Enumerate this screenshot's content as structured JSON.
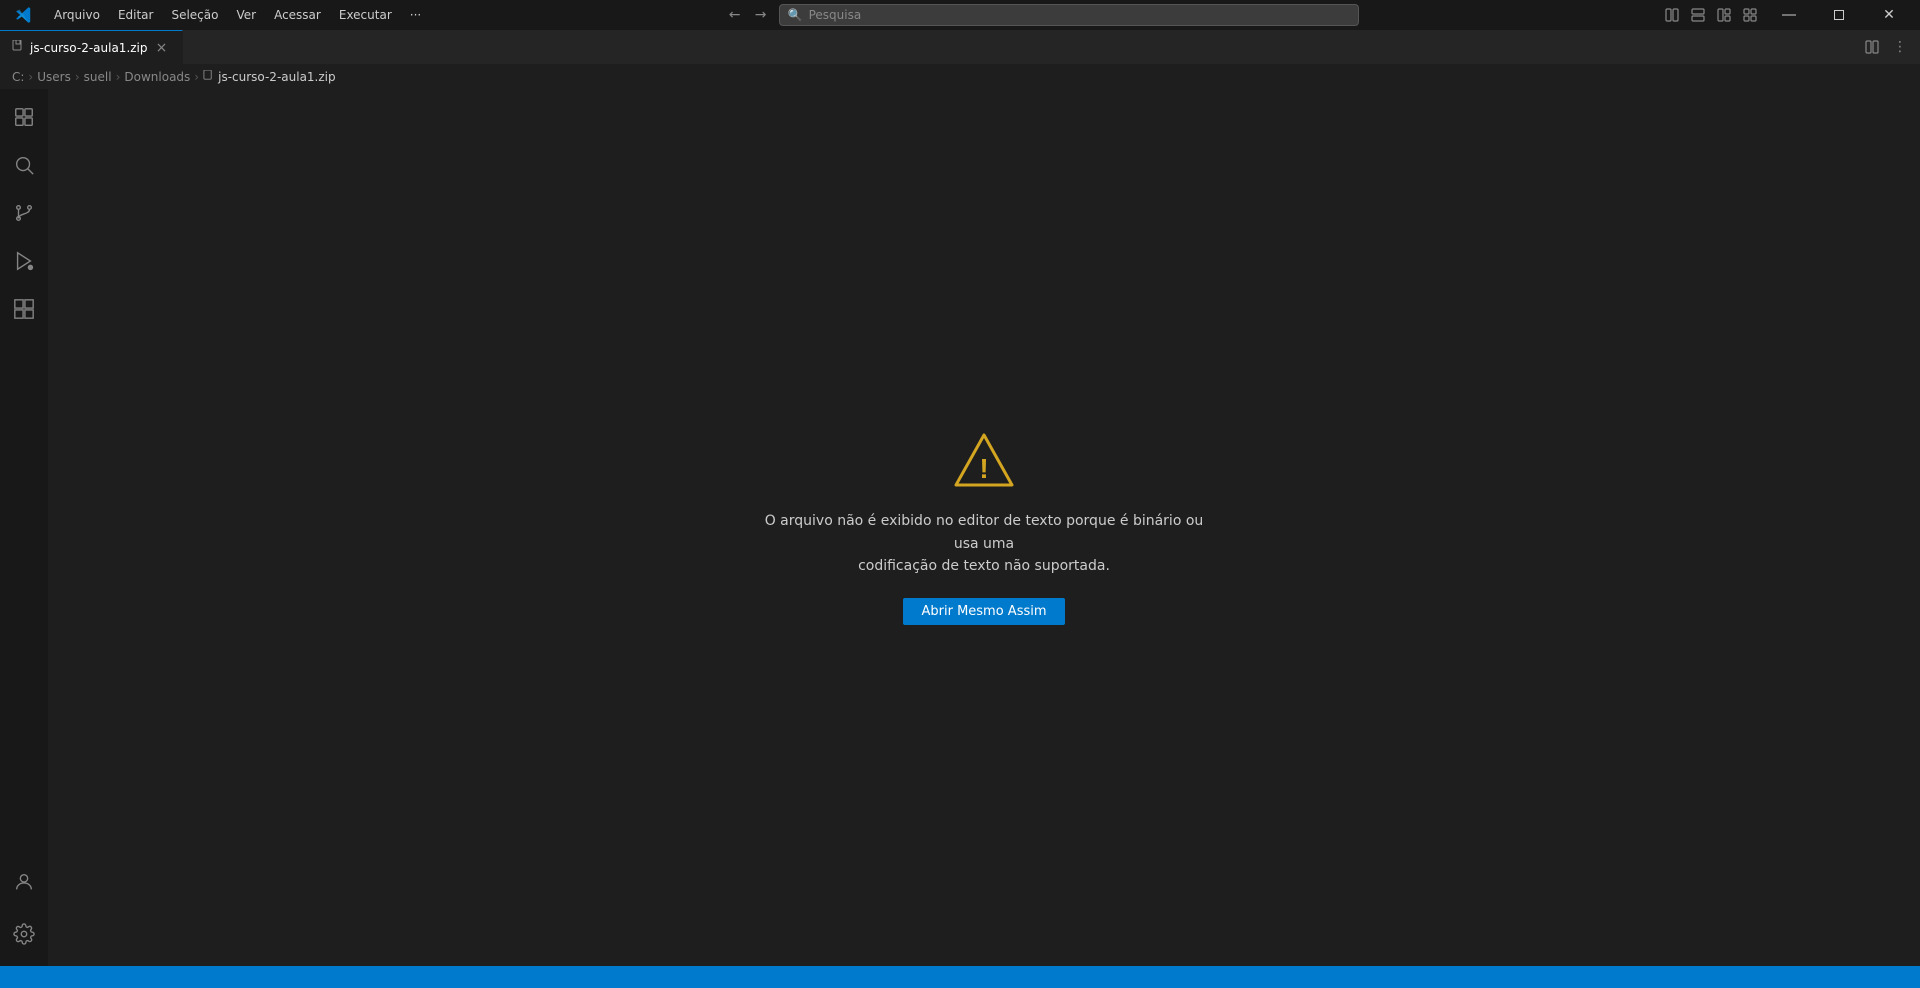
{
  "titlebar": {
    "logo": "VS",
    "menus": [
      "Arquivo",
      "Editar",
      "Seleção",
      "Ver",
      "Acessar",
      "Executar",
      "···"
    ],
    "search_placeholder": "Pesquisa",
    "window_controls": {
      "minimize": "—",
      "maximize": "❐",
      "close": "✕"
    }
  },
  "tab": {
    "label": "js-curso-2-aula1.zip",
    "icon": "📄",
    "close": "×"
  },
  "breadcrumb": {
    "parts": [
      "C:",
      "Users",
      "suell",
      "Downloads",
      "js-curso-2-aula1.zip"
    ]
  },
  "activity_bar": {
    "items": [
      {
        "name": "explorer",
        "icon": "⧉"
      },
      {
        "name": "search",
        "icon": "🔍"
      },
      {
        "name": "source-control",
        "icon": "⎇"
      },
      {
        "name": "run-debug",
        "icon": "▷"
      },
      {
        "name": "extensions",
        "icon": "⊞"
      }
    ],
    "bottom": [
      {
        "name": "account",
        "icon": "👤"
      },
      {
        "name": "settings",
        "icon": "⚙"
      }
    ]
  },
  "editor": {
    "warning_message_line1": "O arquivo não é exibido no editor de texto porque é binário ou usa uma",
    "warning_message_line2": "codificação de texto não suportada.",
    "open_anyway_label": "Abrir Mesmo Assim"
  }
}
